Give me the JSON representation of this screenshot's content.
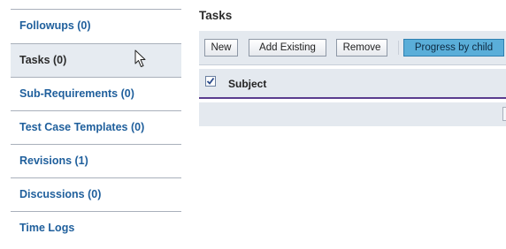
{
  "sidebar": {
    "items": [
      {
        "label": "Followups (0)",
        "active": false
      },
      {
        "label": "Tasks (0)",
        "active": true
      },
      {
        "label": "Sub-Requirements (0)",
        "active": false
      },
      {
        "label": "Test Case Templates (0)",
        "active": false
      },
      {
        "label": "Revisions (1)",
        "active": false
      },
      {
        "label": "Discussions (0)",
        "active": false
      },
      {
        "label": "Time Logs",
        "active": false
      }
    ]
  },
  "main": {
    "title": "Tasks",
    "toolbar": {
      "new_label": "New",
      "add_existing_label": "Add Existing",
      "remove_label": "Remove",
      "progress_label": "Progress by child"
    },
    "grid": {
      "select_all_checked": true,
      "columns": [
        "Subject"
      ]
    }
  },
  "colors": {
    "link": "#1f5f9c",
    "active_bg": "#e6ebf1",
    "toolbar_bg": "#e4e9ef",
    "primary_button": "#5aaed9",
    "header_rule": "#5a3d8e"
  },
  "icons": {
    "cursor": "mouse-pointer-icon",
    "checkbox": "checkbox-checked-icon"
  }
}
